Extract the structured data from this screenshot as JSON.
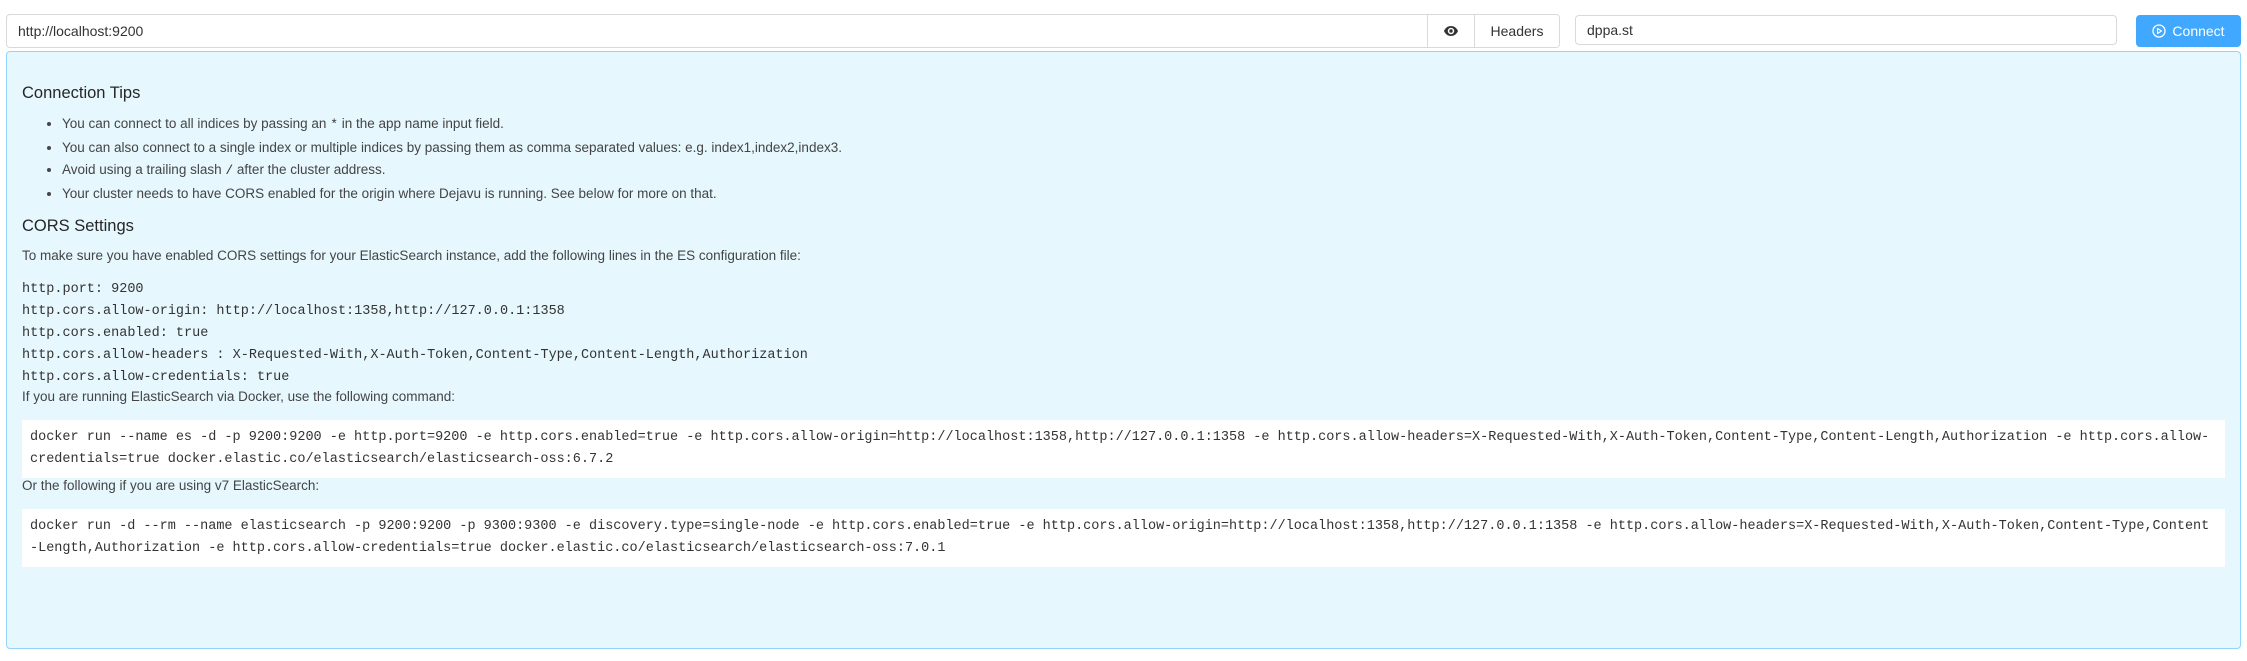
{
  "toolbar": {
    "url_value": "http://localhost:9200",
    "headers_label": "Headers",
    "app_value": "dppa.st",
    "connect_label": "Connect",
    "accent_color": "#40a9ff"
  },
  "tips": {
    "title": "Connection Tips",
    "items": [
      {
        "before": "You can connect to all indices by passing an ",
        "code": "*",
        "after": " in the app name input field."
      },
      {
        "before": "You can also connect to a single index or multiple indices by passing them as comma separated values: e.g. index1,index2,index3.",
        "code": "",
        "after": ""
      },
      {
        "before": "Avoid using a trailing slash ",
        "code": "/",
        "after": " after the cluster address."
      },
      {
        "before": "Your cluster needs to have CORS enabled for the origin where Dejavu is running. See below for more on that.",
        "code": "",
        "after": ""
      }
    ]
  },
  "cors": {
    "title": "CORS Settings",
    "intro": "To make sure you have enabled CORS settings for your ElasticSearch instance, add the following lines in the ES configuration file:",
    "config_lines": [
      "http.port: 9200",
      "http.cors.allow-origin: http://localhost:1358,http://127.0.0.1:1358",
      "http.cors.enabled: true",
      "http.cors.allow-headers : X-Requested-With,X-Auth-Token,Content-Type,Content-Length,Authorization",
      "http.cors.allow-credentials: true"
    ],
    "docker_intro": "If you are running ElasticSearch via Docker, use the following command:",
    "docker_cmd": "docker run --name es -d -p 9200:9200 -e http.port=9200 -e http.cors.enabled=true -e http.cors.allow-origin=http://localhost:1358,http://127.0.0.1:1358 -e http.cors.allow-headers=X-Requested-With,X-Auth-Token,Content-Type,Content-Length,Authorization -e http.cors.allow-credentials=true docker.elastic.co/elasticsearch/elasticsearch-oss:6.7.2",
    "v7_intro": "Or the following if you are using v7 ElasticSearch:",
    "v7_cmd": "docker run -d --rm --name elasticsearch -p 9200:9200 -p 9300:9300 -e discovery.type=single-node -e http.cors.enabled=true -e http.cors.allow-origin=http://localhost:1358,http://127.0.0.1:1358 -e http.cors.allow-headers=X-Requested-With,X-Auth-Token,Content-Type,Content-Length,Authorization -e http.cors.allow-credentials=true docker.elastic.co/elasticsearch/elasticsearch-oss:7.0.1"
  }
}
